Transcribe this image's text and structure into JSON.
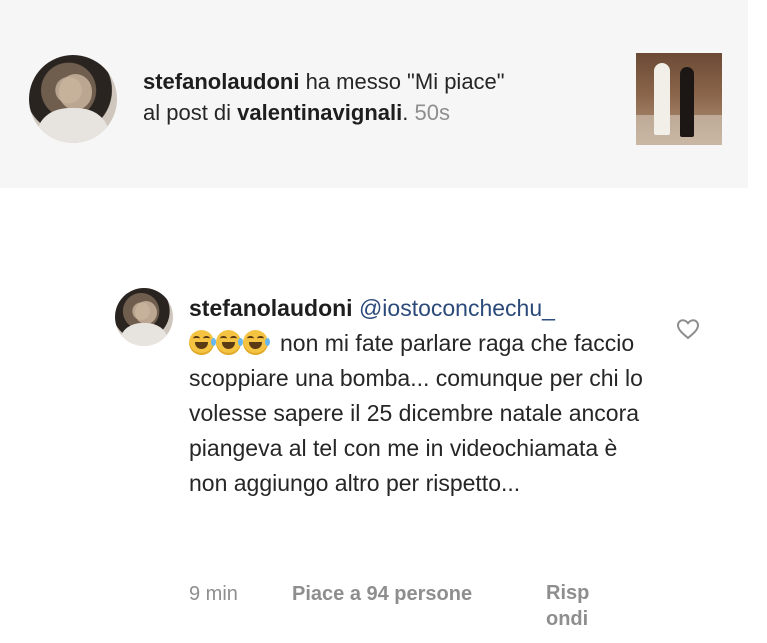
{
  "notification": {
    "username": "stefanolaudoni",
    "action_prefix": " ha messo \"Mi piace\"",
    "action_mid": "al post di ",
    "target_user": "valentinavignali",
    "target_suffix": ".",
    "time": " 50s"
  },
  "comment": {
    "username": "stefanolaudoni",
    "mention": "@iostoconchechu_",
    "emojis": [
      "grinning-tears-emoji",
      "grinning-tears-emoji",
      "grinning-tears-emoji"
    ],
    "text_first": "non mi fate parlare raga",
    "text_rest": "che faccio scoppiare una bomba... comunque per chi lo volesse sapere il 25 dicembre natale ancora piangeva al tel con me in videochiamata è non aggiungo altro per rispetto...",
    "time": "9 min",
    "likes": "Piace a 94 persone",
    "reply": "Risp ondi"
  },
  "colors": {
    "notification_bg": "#f6f6f6",
    "text": "#262626",
    "muted": "#8e8e8e",
    "mention": "#2b4a7a"
  }
}
